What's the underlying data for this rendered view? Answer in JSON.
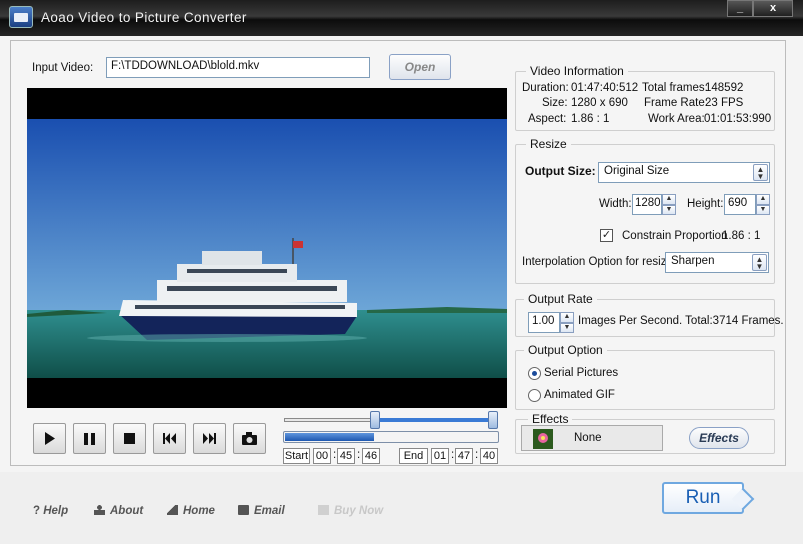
{
  "window": {
    "title": "Aoao Video to Picture Converter",
    "min_label": "_",
    "close_label": "x"
  },
  "input": {
    "label": "Input Video:",
    "value": "F:\\TDDOWNLOAD\\blold.mkv",
    "open_label": "Open"
  },
  "video_info": {
    "title": "Video Information",
    "duration_label": "Duration:",
    "duration": "01:47:40:512",
    "total_frames_label": "Total frames:",
    "total_frames": "148592",
    "size_label": "Size:",
    "size": "1280 x 690",
    "frame_rate_label": "Frame Rate:",
    "frame_rate": "23 FPS",
    "aspect_label": "Aspect:",
    "aspect": "1.86 : 1",
    "work_area_label": "Work Area:",
    "work_area": "01:01:53:990"
  },
  "resize": {
    "title": "Resize",
    "output_size_label": "Output Size:",
    "output_size": "Original Size",
    "width_label": "Width:",
    "width": "1280",
    "height_label": "Height:",
    "height": "690",
    "constrain_label": "Constrain Proportion",
    "constrain_checked": true,
    "constrain_ratio": "1.86 : 1",
    "interp_label": "Interpolation Option for resize:",
    "interp_value": "Sharpen"
  },
  "output_rate": {
    "title": "Output Rate",
    "value": "1.00",
    "text": "Images Per Second. Total:3714 Frames."
  },
  "output_option": {
    "title": "Output Option",
    "options": [
      "Serial Pictures",
      "Animated GIF"
    ],
    "selected": "Serial Pictures"
  },
  "effects": {
    "title": "Effects",
    "value": "None",
    "button": "Effects"
  },
  "timeline": {
    "start_label": "Start",
    "start": [
      "00",
      "45",
      "46"
    ],
    "end_label": "End",
    "end": [
      "01",
      "47",
      "40"
    ],
    "range_start_fraction": 0.42,
    "range_end_fraction": 1.0,
    "progress_fraction": 0.42
  },
  "footer": {
    "help": "Help",
    "about": "About",
    "home": "Home",
    "email": "Email",
    "buy_now": "Buy Now",
    "run": "Run"
  },
  "colors": {
    "accent": "#1a5fb4",
    "slider": "#3a7bd5"
  }
}
